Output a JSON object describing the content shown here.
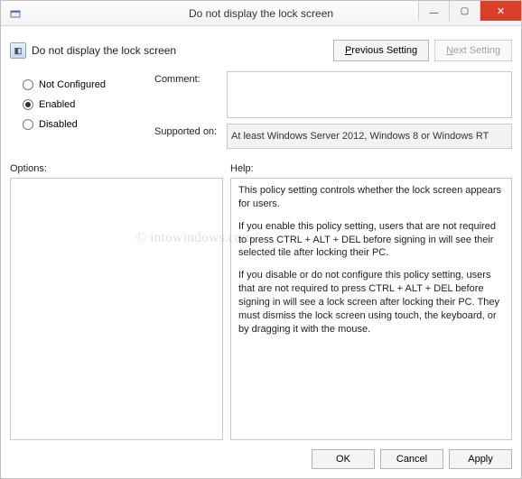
{
  "window": {
    "title": "Do not display the lock screen",
    "header_title": "Do not display the lock screen"
  },
  "nav": {
    "previous": "Previous Setting",
    "next": "Next Setting"
  },
  "radios": {
    "not_configured": "Not Configured",
    "enabled": "Enabled",
    "disabled": "Disabled",
    "selected": "enabled"
  },
  "fields": {
    "comment_label": "Comment:",
    "comment_value": "",
    "supported_label": "Supported on:",
    "supported_value": "At least Windows Server 2012, Windows 8 or Windows RT"
  },
  "panels": {
    "options_label": "Options:",
    "help_label": "Help:",
    "options_text": "",
    "help_p1": "This policy setting controls whether the lock screen appears for users.",
    "help_p2": "If you enable this policy setting, users that are not required to press CTRL + ALT + DEL before signing in will see their selected tile after  locking their PC.",
    "help_p3": "If you disable or do not configure this policy setting, users that are not required to press CTRL + ALT + DEL before signing in will see a lock screen after locking their PC. They must dismiss the lock screen using touch, the keyboard, or by dragging it with the mouse."
  },
  "footer": {
    "ok": "OK",
    "cancel": "Cancel",
    "apply": "Apply"
  },
  "watermark": "© intowindows.com"
}
